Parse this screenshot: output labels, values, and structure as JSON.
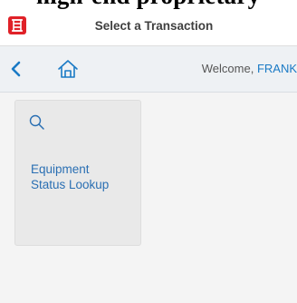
{
  "top_heading": "high-end proprietary",
  "header": {
    "title": "Select a Transaction"
  },
  "subbar": {
    "welcome_prefix": "Welcome, ",
    "username": "FRANK"
  },
  "tiles": [
    {
      "icon": "search-icon",
      "label_line1": "Equipment",
      "label_line2": "Status Lookup"
    }
  ],
  "colors": {
    "logo": "#e02128",
    "nav_icons": "#1a7ac5",
    "username": "#1a7ac5",
    "tile_label": "#2a6fb3"
  }
}
